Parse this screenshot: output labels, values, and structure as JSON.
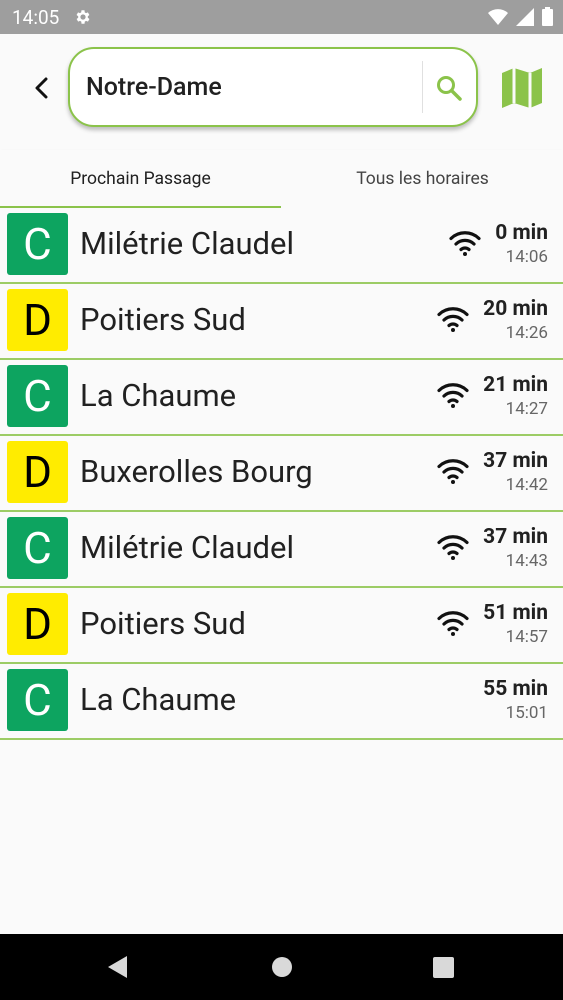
{
  "status": {
    "time": "14:05"
  },
  "search": {
    "query": "Notre-Dame"
  },
  "tabs": [
    {
      "label": "Prochain Passage",
      "active": true
    },
    {
      "label": "Tous les horaires",
      "active": false
    }
  ],
  "departures": [
    {
      "line": "C",
      "destination": "Milétrie Claudel",
      "realtime": true,
      "minutes": "0 min",
      "time": "14:06"
    },
    {
      "line": "D",
      "destination": "Poitiers Sud",
      "realtime": true,
      "minutes": "20 min",
      "time": "14:26"
    },
    {
      "line": "C",
      "destination": "La Chaume",
      "realtime": true,
      "minutes": "21 min",
      "time": "14:27"
    },
    {
      "line": "D",
      "destination": "Buxerolles Bourg",
      "realtime": true,
      "minutes": "37 min",
      "time": "14:42"
    },
    {
      "line": "C",
      "destination": "Milétrie Claudel",
      "realtime": true,
      "minutes": "37 min",
      "time": "14:43"
    },
    {
      "line": "D",
      "destination": "Poitiers Sud",
      "realtime": true,
      "minutes": "51 min",
      "time": "14:57"
    },
    {
      "line": "C",
      "destination": "La Chaume",
      "realtime": false,
      "minutes": "55 min",
      "time": "15:01"
    }
  ],
  "colors": {
    "accent": "#8bc34a",
    "line_C": "#0da460",
    "line_D": "#ffec00"
  }
}
